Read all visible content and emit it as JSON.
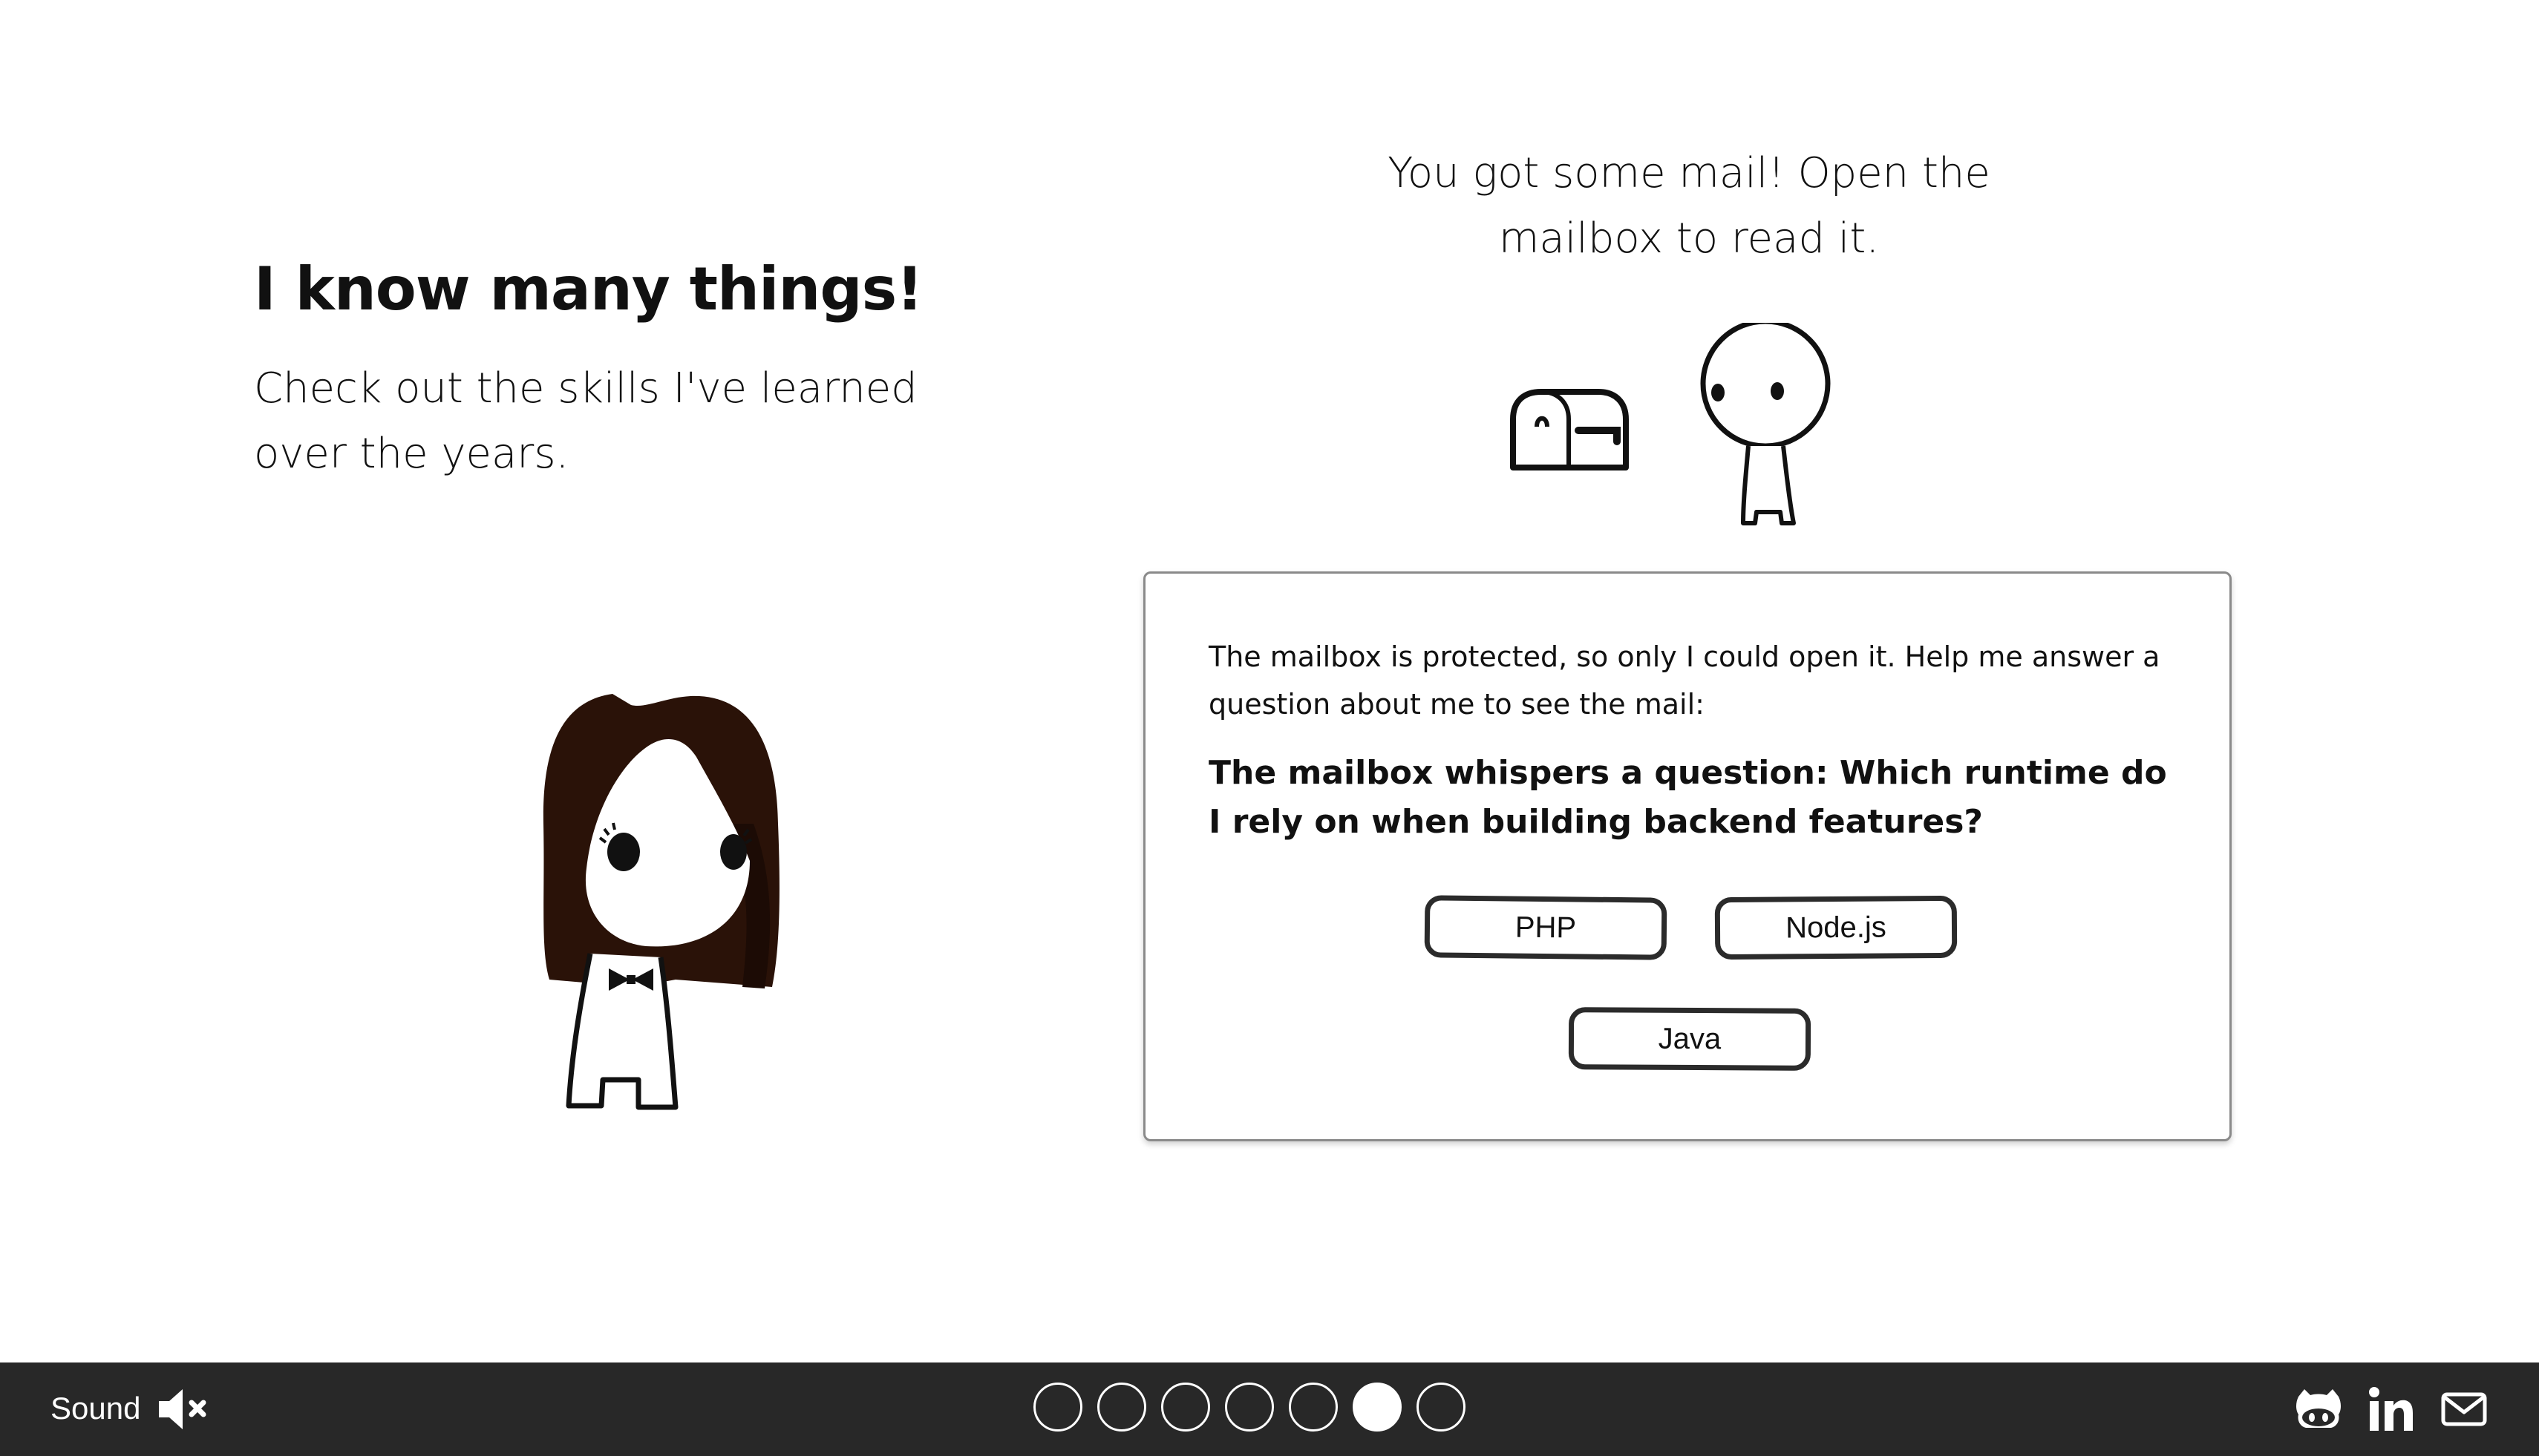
{
  "section": {
    "title": "I know many things!",
    "subtitle": "Check out the skills I've learned over the years."
  },
  "mail": {
    "hint": "You got some mail! Open the mailbox to read it."
  },
  "quiz": {
    "intro": "The mailbox is protected, so only I could open it. Help me answer a question about me to see the mail:",
    "question": "The mailbox whispers a question: Which runtime do I rely on when building backend features?",
    "answers": [
      "PHP",
      "Node.js",
      "Java"
    ]
  },
  "footer": {
    "sound_label": "Sound",
    "sound_state": "muted",
    "sound_icon": "speaker-muted-icon",
    "pages": {
      "count": 7,
      "active": 6
    },
    "social_icons": [
      "github-icon",
      "linkedin-icon",
      "mail-icon"
    ]
  },
  "colors": {
    "footer_bg": "#282828",
    "hair": "#2a1208",
    "panel_border": "#8a8a8a"
  }
}
